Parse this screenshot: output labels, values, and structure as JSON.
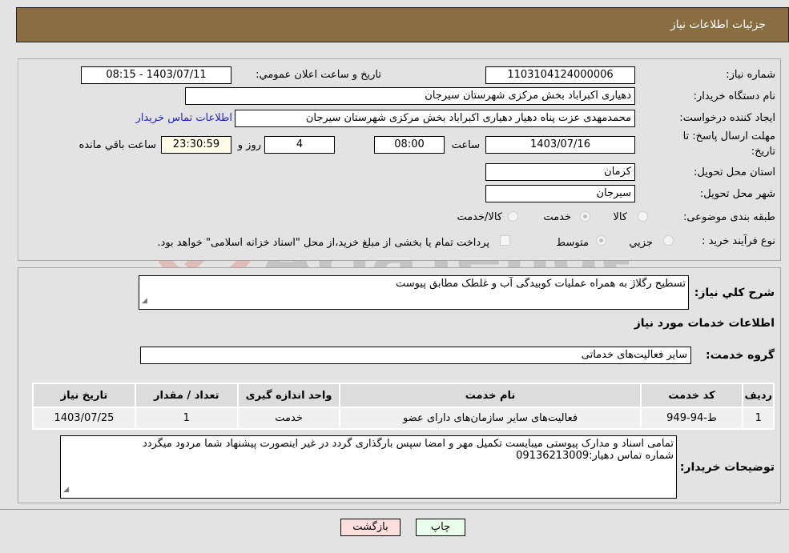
{
  "header": {
    "title": "جزئیات اطلاعات نیاز"
  },
  "form": {
    "need_number": {
      "label": "شماره نیاز:",
      "value": "1103104124000006"
    },
    "announce_datetime": {
      "label": "تاریخ و ساعت اعلان عمومي:",
      "value": "1403/07/11 - 08:15"
    },
    "buyer_org": {
      "label": "نام دستگاه خريدار:",
      "value": "دهیاری اکبراباد بخش مرکزی شهرستان سیرجان"
    },
    "requester": {
      "label": "ایجاد کننده درخواست:",
      "value": "محمدمهدی عزت پناه دهیار دهیاری اکبراباد بخش مرکزی شهرستان سیرجان"
    },
    "contact_link": "اطلاعات تماس خریدار",
    "deadline": {
      "label_line1": "مهلت ارسال پاسخ: تا",
      "label_line2": "تاریخ:",
      "date": "1403/07/16",
      "time_label": "ساعت",
      "time": "08:00",
      "days": "4",
      "days_label": "روز و",
      "remaining": "23:30:59",
      "remaining_label": "ساعت باقي مانده"
    },
    "province": {
      "label": "استان محل تحویل:",
      "value": "کرمان"
    },
    "city": {
      "label": "شهر محل تحویل:",
      "value": "سیرجان"
    },
    "category": {
      "label": "طبقه بندی موضوعی:",
      "options": [
        "کالا",
        "خدمت",
        "کالا/خدمت"
      ],
      "selected": "خدمت"
    },
    "purchase_type": {
      "label": "نوع فرآیند خرید :",
      "options": [
        "جزيي",
        "متوسط"
      ],
      "selected": "متوسط",
      "treasury_note": "پرداخت تمام یا بخشی از مبلغ خرید،از محل \"اسناد خزانه اسلامی\" خواهد بود."
    }
  },
  "details": {
    "description_label": "شرح کلي نياز:",
    "description": "تسطیح رگلاژ به همراه عملیات کوبیدگی آب و غلطک مطابق پیوست",
    "services_title": "اطلاعات خدمات مورد نياز",
    "service_group_label": "گروه خدمت:",
    "service_group": "سایر فعالیت‌های خدماتی",
    "table": {
      "headers": [
        "رديف",
        "کد خدمت",
        "نام خدمت",
        "واحد اندازه گيری",
        "تعداد / مقدار",
        "تاريخ نياز"
      ],
      "rows": [
        [
          "1",
          "ط-94-949",
          "فعالیت‌های سایر سازمان‌های دارای عضو",
          "خدمت",
          "1",
          "1403/07/25"
        ]
      ]
    },
    "buyer_notes_label": "توضيحات خريدار:",
    "buyer_notes_line1": "تمامی اسناد و مدارک پیوستی میبایست تکمیل مهر و امضا سپس بارگذاری گردد در غیر اینصورت پیشنهاد شما مردود میگردد",
    "buyer_notes_line2": "شماره تماس دهیار:09136213009"
  },
  "buttons": {
    "print": "چاپ",
    "back": "بازگشت"
  },
  "watermark": "AriaTender.neT",
  "colors": {
    "header_bg": "#8b6d42",
    "link": "#2323c8",
    "print_bg": "#eaffea",
    "back_bg": "#ffdede"
  }
}
